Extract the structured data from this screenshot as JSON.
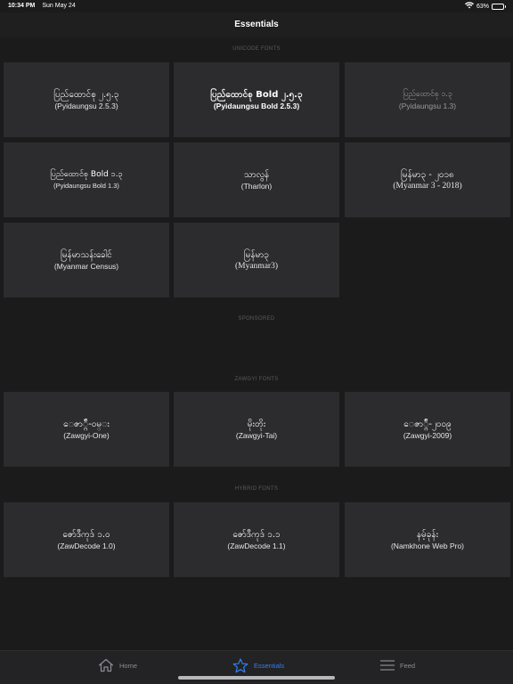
{
  "status": {
    "time": "10:34 PM",
    "date": "Sun May 24",
    "battery": "63%",
    "battery_level": 0.63
  },
  "nav": {
    "title": "Essentials"
  },
  "sections": {
    "unicode": {
      "title": "UNICODE FONTS",
      "tiles": [
        {
          "name": "ပြည်ထောင်စု ၂.၅.၃",
          "sub": "(Pyidaungsu 2.5.3)"
        },
        {
          "name": "ပြည်ထောင်စု Bold ၂.၅.၃",
          "sub": "(Pyidaungsu Bold 2.5.3)"
        },
        {
          "name": "ပြည်ထောင်စု ၁.၃",
          "sub": "(Pyidaungsu 1.3)"
        },
        {
          "name": "ပြည်ထောင်စု Bold ၁.၃",
          "sub": "(Pyidaungsu Bold 1.3)"
        },
        {
          "name": "သာလွန်",
          "sub": "(Tharlon)"
        },
        {
          "name": "မြန်မာ၃ - ၂၀၁၈",
          "sub": "(Myanmar 3 - 2018)"
        },
        {
          "name": "မြန်မာသန်းခေါင်",
          "sub": "(Myanmar Census)"
        },
        {
          "name": "မြန်မာ၃",
          "sub": "(Myanmar3)"
        }
      ]
    },
    "sponsored": {
      "title": "SPONSORED"
    },
    "zawgyi": {
      "title": "ZAWGYI FONTS",
      "tiles": [
        {
          "name": "ေဇာ္ဂ်ီ-ဝမ္း",
          "sub": "(Zawgyi-One)"
        },
        {
          "name": "မိုးတိုး",
          "sub": "(Zawgyi-Tai)"
        },
        {
          "name": "ေဇာ္ဂ်ီ-၂၀၀၉",
          "sub": "(Zawgyi-2009)"
        }
      ]
    },
    "hybrid": {
      "title": "HYBRID FONTS",
      "tiles": [
        {
          "name": "ဇော်ဒီကုဒ် ၁.၀",
          "sub": "(ZawDecode 1.0)"
        },
        {
          "name": "ဇော်ဒီကုဒ် ၁.၁",
          "sub": "(ZawDecode 1.1)"
        },
        {
          "name": "နမ့်ခုန်း",
          "sub": "(Namkhone Web Pro)"
        }
      ]
    }
  },
  "tabbar": {
    "home": "Home",
    "essentials": "Essentials",
    "feed": "Feed",
    "active_color": "#2f80ed",
    "inactive_color": "#8e8e93"
  }
}
